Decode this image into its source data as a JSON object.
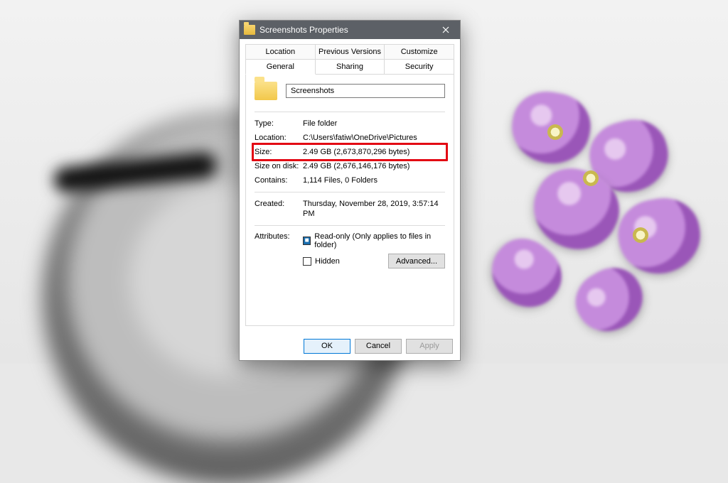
{
  "titlebar": {
    "title": "Screenshots Properties"
  },
  "tabs_row1": {
    "location": "Location",
    "previous": "Previous Versions",
    "customize": "Customize"
  },
  "tabs_row2": {
    "general": "General",
    "sharing": "Sharing",
    "security": "Security"
  },
  "folder": {
    "name": "Screenshots"
  },
  "fields": {
    "type_k": "Type:",
    "type_v": "File folder",
    "location_k": "Location:",
    "location_v": "C:\\Users\\fatiw\\OneDrive\\Pictures",
    "size_k": "Size:",
    "size_v": "2.49 GB (2,673,870,296 bytes)",
    "sod_k": "Size on disk:",
    "sod_v": "2.49 GB (2,676,146,176 bytes)",
    "contains_k": "Contains:",
    "contains_v": "1,114 Files, 0 Folders",
    "created_k": "Created:",
    "created_v": "Thursday, November 28, 2019, 3:57:14 PM",
    "attributes_k": "Attributes:",
    "readonly": "Read-only (Only applies to files in folder)",
    "hidden": "Hidden",
    "advanced": "Advanced..."
  },
  "buttons": {
    "ok": "OK",
    "cancel": "Cancel",
    "apply": "Apply"
  }
}
